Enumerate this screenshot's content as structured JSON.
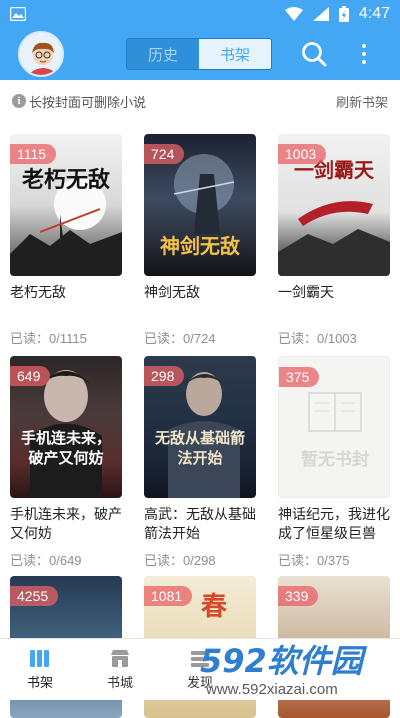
{
  "status_bar": {
    "time": "4:47"
  },
  "header": {
    "tabs": [
      {
        "label": "历史",
        "active": false
      },
      {
        "label": "书架",
        "active": true
      }
    ]
  },
  "hint": {
    "text": "长按封面可删除小说",
    "refresh": "刷新书架"
  },
  "books": [
    {
      "badge": "1115",
      "title": "老朽无敌",
      "read": "已读：0/1115",
      "cover_text": "老朽无敌"
    },
    {
      "badge": "724",
      "title": "神剑无敌",
      "read": "已读：0/724",
      "cover_text": "神剑无敌"
    },
    {
      "badge": "1003",
      "title": "一剑霸天",
      "read": "已读：0/1003",
      "cover_text": "一剑霸天"
    },
    {
      "badge": "649",
      "title": "手机连未来，破产又何妨",
      "read": "已读：0/649",
      "cover_text": "手机连未来，破产又何妨"
    },
    {
      "badge": "298",
      "title": "高武：无敌从基础箭法开始",
      "read": "已读：0/298",
      "cover_text": "无敌从基础箭法开始"
    },
    {
      "badge": "375",
      "title": "神话纪元，我进化成了恒星级巨兽",
      "read": "已读：0/375",
      "cover_text": "暂无书封"
    },
    {
      "badge": "4255",
      "title": "",
      "read": "",
      "cover_text": ""
    },
    {
      "badge": "1081",
      "title": "",
      "read": "",
      "cover_text": "春"
    },
    {
      "badge": "339",
      "title": "",
      "read": "",
      "cover_text": ""
    }
  ],
  "bottom_nav": [
    {
      "label": "书架",
      "icon": "bookshelf-icon",
      "active": true
    },
    {
      "label": "书城",
      "icon": "store-icon",
      "active": false
    },
    {
      "label": "发现",
      "icon": "discover-icon",
      "active": false
    }
  ],
  "watermark": {
    "brand": "592软件园",
    "url": "www.592xiazai.com"
  },
  "colors": {
    "primary": "#43a7f4",
    "badge": "#e86064",
    "muted": "#8e8e8e"
  }
}
